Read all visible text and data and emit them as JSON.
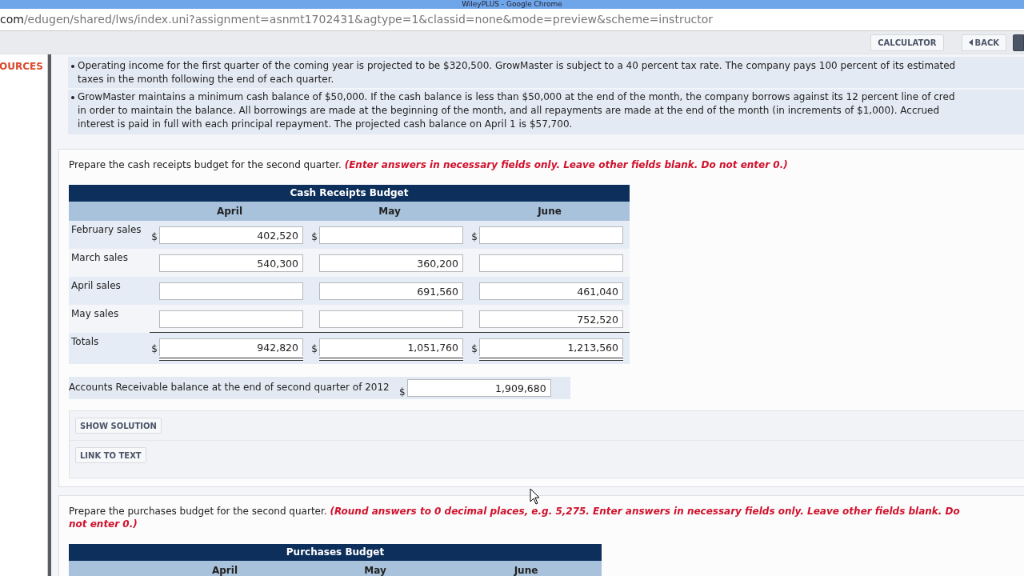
{
  "window": {
    "title": "WileyPLUS - Google Chrome"
  },
  "address_bar": {
    "host": "com",
    "path": "/edugen/shared/lws/index.uni?assignment=asnmt1702431&agtype=1&classid=none&mode=preview&scheme=instructor"
  },
  "toolbar": {
    "buttons": [
      {
        "label": "CALCULATOR",
        "kind": "plain"
      },
      {
        "label": "BACK",
        "kind": "back"
      },
      {
        "kind": "dark"
      }
    ]
  },
  "sidebar": {
    "heading": "OURCES"
  },
  "bullets": [
    {
      "lines": [
        "Operating income for the first quarter of the coming year is projected to be $320,500. GrowMaster is subject to a 40 percent tax rate. The company pays 100 percent of its estimated",
        "taxes in the month following the end of each quarter."
      ]
    },
    {
      "lines": [
        "GrowMaster maintains a minimum cash balance of $50,000. If the cash balance is less than $50,000 at the end of the month, the company borrows against its 12 percent line of cred",
        "in order to maintain the balance. All borrowings are made at the beginning of the month, and all repayments are made at the end of the month (in increments of $1,000). Accrued",
        "interest is paid in full with each principal repayment. The projected cash balance on April 1 is $57,700."
      ]
    }
  ],
  "questions": [
    {
      "instruction": "Prepare the cash receipts budget for the second quarter.",
      "note_lines": [
        "(Enter answers in necessary fields only. Leave other fields blank. Do not enter 0.)"
      ],
      "table": {
        "title": "Cash Receipts Budget",
        "columns": [
          "April",
          "May",
          "June"
        ],
        "rows": [
          {
            "label": "February sales",
            "kind": "item",
            "cells": [
              {
                "currency": "$",
                "value": "402,520"
              },
              {
                "currency": "$"
              },
              {
                "currency": "$"
              }
            ]
          },
          {
            "label": "March sales",
            "kind": "item",
            "cells": [
              {
                "value": "540,300"
              },
              {
                "value": "360,200"
              },
              {}
            ]
          },
          {
            "label": "April sales",
            "kind": "item",
            "cells": [
              {},
              {
                "value": "691,560"
              },
              {
                "value": "461,040"
              }
            ]
          },
          {
            "label": "May sales",
            "kind": "subtotal",
            "cells": [
              {},
              {},
              {
                "value": "752,520"
              }
            ]
          },
          {
            "label": "Totals",
            "kind": "total",
            "cells": [
              {
                "currency": "$",
                "value": "942,820"
              },
              {
                "currency": "$",
                "value": "1,051,760"
              },
              {
                "currency": "$",
                "value": "1,213,560"
              }
            ]
          }
        ]
      },
      "balance": {
        "label": "Accounts Receivable balance at the end of second quarter of 2012",
        "currency": "$",
        "value": "1,909,680"
      },
      "buttons": [
        "SHOW SOLUTION",
        "LINK TO TEXT"
      ]
    },
    {
      "instruction": "Prepare the purchases budget for the second quarter.",
      "note_lines": [
        "(Round answers to 0 decimal places, e.g. 5,275. Enter answers in necessary fields only. Leave other fields blank. Do",
        "not enter 0.)"
      ],
      "table": {
        "title": "Purchases Budget",
        "columns": [
          "April",
          "May",
          "June"
        ]
      }
    }
  ]
}
